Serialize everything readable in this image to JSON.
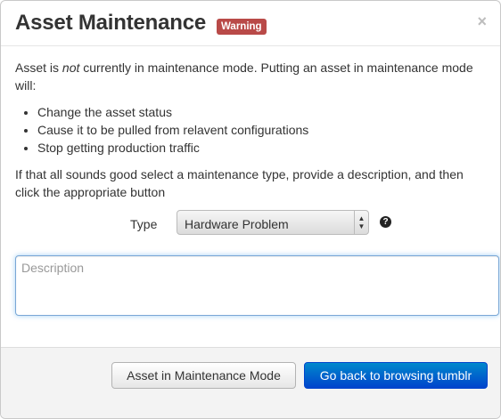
{
  "modal": {
    "title": "Asset Maintenance",
    "badge": "Warning",
    "close_glyph": "×"
  },
  "body": {
    "intro_before": "Asset is ",
    "intro_emphasis": "not",
    "intro_after": " currently in maintenance mode. Putting an asset in maintenance mode will:",
    "effects": [
      "Change the asset status",
      "Cause it to be pulled from relavent configurations",
      "Stop getting production traffic"
    ],
    "instructions": "If that all sounds good select a maintenance type, provide a description, and then click the appropriate button"
  },
  "form": {
    "type_label": "Type",
    "type_selected": "Hardware Problem",
    "help_glyph": "?",
    "description_placeholder": "Description",
    "description_value": ""
  },
  "footer": {
    "maintenance_button": "Asset in Maintenance Mode",
    "back_button": "Go back to browsing tumblr"
  },
  "colors": {
    "badge": "#b94a48",
    "primary": "#0044cc",
    "focus_border": "#7aa7d6"
  }
}
